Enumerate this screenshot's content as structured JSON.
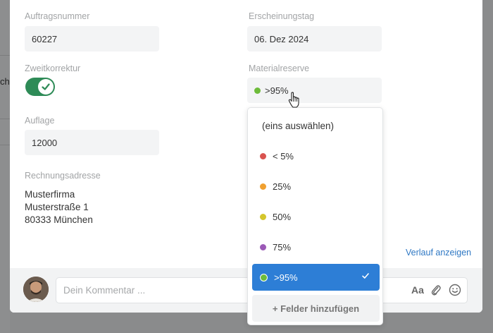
{
  "backdrop": {
    "partial_text": "ch"
  },
  "form": {
    "order_number": {
      "label": "Auftragsnummer",
      "value": "60227"
    },
    "publish_date": {
      "label": "Erscheinungstag",
      "value": "06. Dez 2024"
    },
    "second_proof": {
      "label": "Zweitkorrektur",
      "enabled": true
    },
    "material_reserve": {
      "label": "Materialreserve",
      "value": ">95%",
      "color": "#6dbb3a"
    },
    "circulation": {
      "label": "Auflage",
      "value": "12000"
    },
    "billing_address": {
      "label": "Rechnungsadresse",
      "lines": [
        "Musterfirma",
        "Musterstraße 1",
        "80333 München"
      ]
    },
    "history_link": "Verlauf anzeigen"
  },
  "dropdown": {
    "placeholder": "(eins auswählen)",
    "options": [
      {
        "label": "< 5%",
        "color": "#d9534f"
      },
      {
        "label": "25%",
        "color": "#f0a030"
      },
      {
        "label": "50%",
        "color": "#d4c62c"
      },
      {
        "label": "75%",
        "color": "#9b59b6"
      },
      {
        "label": ">95%",
        "color": "#6dbb3a",
        "selected": true
      }
    ],
    "add_fields_label": "+ Felder hinzufügen"
  },
  "comment": {
    "placeholder": "Dein Kommentar ...",
    "tools": {
      "format": "Aa",
      "attach_icon": "paperclip-icon",
      "emoji_icon": "smiley-icon"
    }
  }
}
